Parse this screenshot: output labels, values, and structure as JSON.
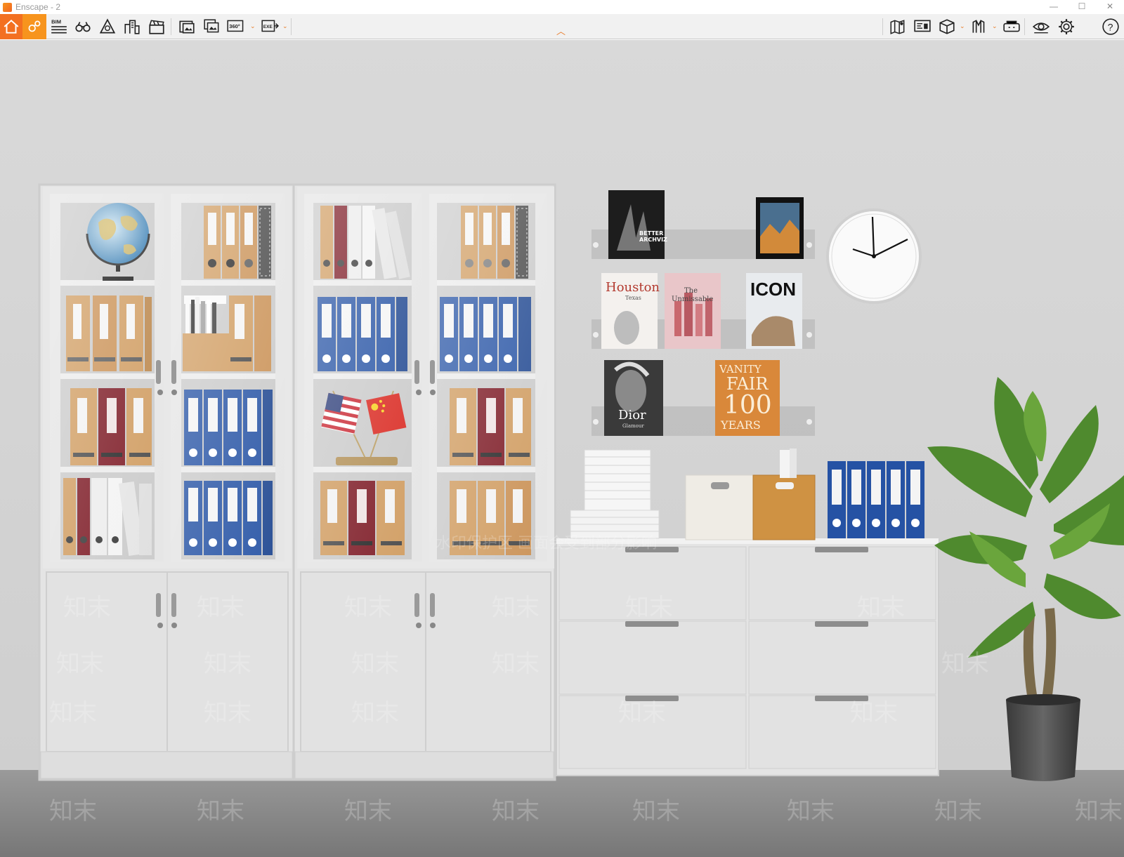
{
  "window": {
    "title": "Enscape - 2",
    "minimize_glyph": "—",
    "maximize_glyph": "☐",
    "close_glyph": "✕"
  },
  "toolbar": {
    "left_tools": [
      {
        "icon": "home-icon"
      },
      {
        "icon": "visual-settings-icon"
      },
      {
        "icon": "bim-icon",
        "label": "BIM"
      },
      {
        "icon": "binoculars-icon"
      },
      {
        "icon": "perspective-icon"
      },
      {
        "icon": "buildings-icon"
      },
      {
        "icon": "clapperboard-icon"
      },
      {
        "icon": "screenshot-icon"
      },
      {
        "icon": "batch-render-icon"
      },
      {
        "icon": "panorama-360-icon",
        "label": "360°"
      },
      {
        "icon": "export-exe-icon",
        "label": "EXE"
      }
    ],
    "right_tools": [
      {
        "icon": "map-icon"
      },
      {
        "icon": "monitor-icon"
      },
      {
        "icon": "asset-library-icon"
      },
      {
        "icon": "material-library-icon"
      },
      {
        "icon": "vr-headset-icon"
      },
      {
        "icon": "eye-icon"
      },
      {
        "icon": "gear-icon"
      },
      {
        "icon": "help-icon",
        "label": "?"
      }
    ],
    "colors": {
      "home": "#f37021",
      "visual": "#f7941d",
      "accent": "#e87722"
    }
  },
  "scene": {
    "magazines": {
      "top_left_line1": "BETTER",
      "top_left_line2": "ARCHVIZ",
      "houston": "Houston",
      "houston_sub": "Texas",
      "unmissable_line1": "The",
      "unmissable_line2": "Unmissable",
      "icon": "ICON",
      "dior": "Dior",
      "dior_sub": "Glamour",
      "vanity_line1": "VANITY",
      "vanity_line2": "FAIR",
      "vanity_line3": "100",
      "vanity_line4": "YEARS"
    },
    "watermarks": {
      "brand": "知末",
      "notice": "水印保护区 画面会受到部分影响"
    },
    "colors": {
      "wall": "#d6d6d6",
      "floor": "#8c8c8c",
      "binder_tan": "#cf9a5d",
      "binder_red": "#7a1520",
      "binder_blue": "#2552a4",
      "binder_white": "#ececec",
      "cabinet": "#e3e3e3"
    }
  }
}
